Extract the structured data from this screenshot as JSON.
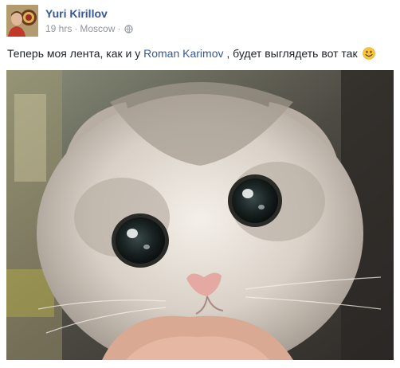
{
  "post": {
    "author": "Yuri Kirillov",
    "time": "19 hrs",
    "location": "Moscow",
    "separator": "·",
    "privacy_icon": "globe-icon",
    "text_before": "Теперь моя лента, как и у ",
    "mention": "Roman Karimov",
    "text_after": " , будет выглядеть вот так ",
    "emoji": "smile-emoji-icon",
    "photo_subject": "kitten-photo"
  },
  "colors": {
    "author_link": "#365899",
    "meta_text": "#90949c",
    "body_text": "#1d2129"
  }
}
